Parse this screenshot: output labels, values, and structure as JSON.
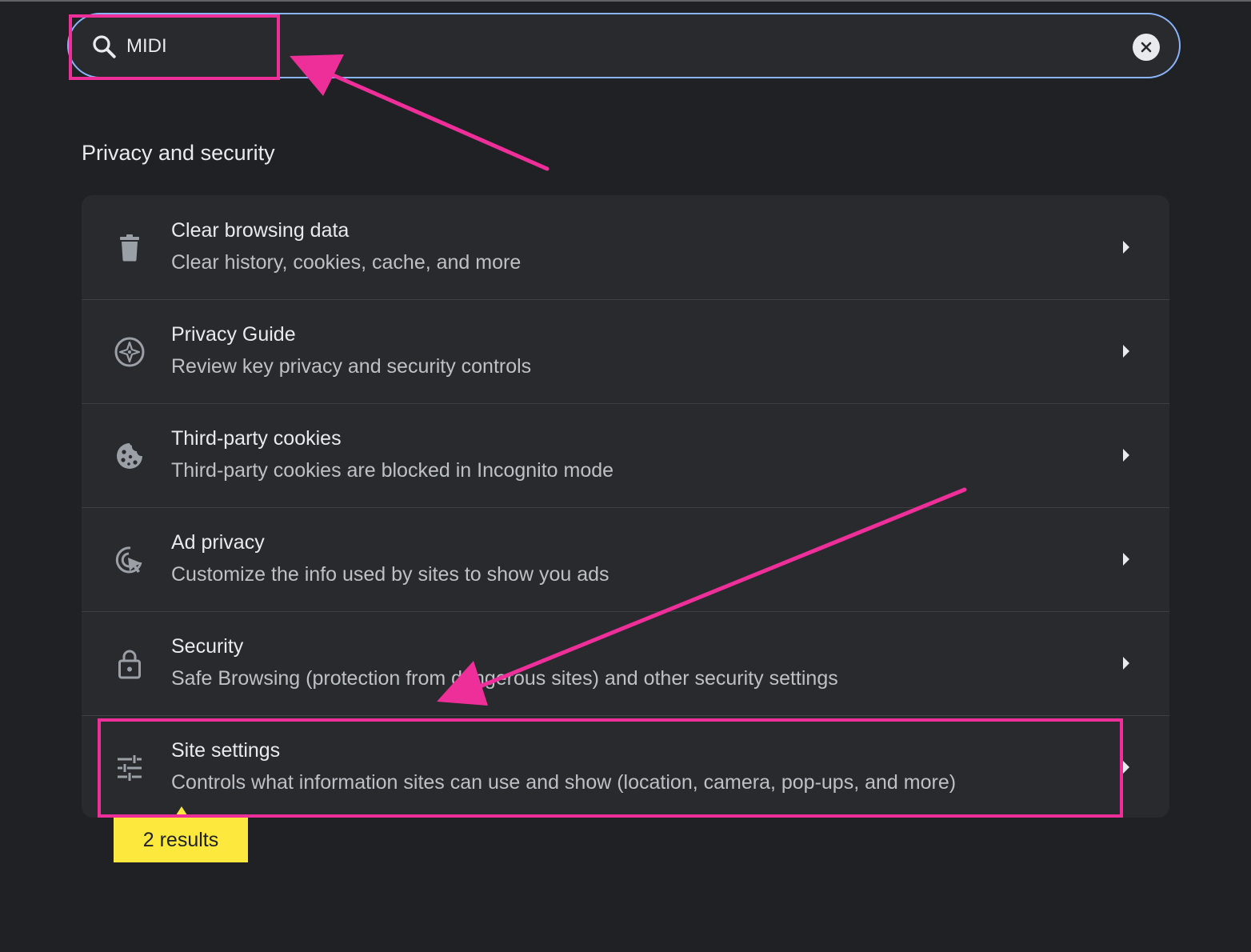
{
  "search": {
    "value": "MIDI",
    "icon": "search-icon",
    "clear_icon": "close-icon"
  },
  "section": {
    "title": "Privacy and security"
  },
  "items": [
    {
      "title": "Clear browsing data",
      "subtitle": "Clear history, cookies, cache, and more",
      "icon": "trash-icon"
    },
    {
      "title": "Privacy Guide",
      "subtitle": "Review key privacy and security controls",
      "icon": "compass-icon"
    },
    {
      "title": "Third-party cookies",
      "subtitle": "Third-party cookies are blocked in Incognito mode",
      "icon": "cookie-icon"
    },
    {
      "title": "Ad privacy",
      "subtitle": "Customize the info used by sites to show you ads",
      "icon": "ad-privacy-icon"
    },
    {
      "title": "Security",
      "subtitle": "Safe Browsing (protection from dangerous sites) and other security settings",
      "icon": "lock-icon"
    },
    {
      "title": "Site settings",
      "subtitle": "Controls what information sites can use and show (location, camera, pop-ups, and more)",
      "icon": "tune-icon"
    }
  ],
  "results_badge": "2 results",
  "colors": {
    "background": "#202124",
    "card": "#292a2d",
    "search_border": "#8ab4f8",
    "annotation": "#ee2f9a",
    "badge": "#fde93e"
  }
}
